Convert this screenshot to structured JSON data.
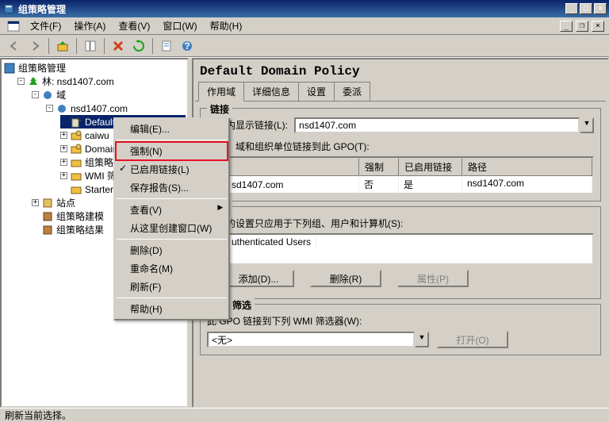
{
  "window": {
    "title": "组策略管理"
  },
  "menubar": {
    "file": "文件(F)",
    "action": "操作(A)",
    "view": "查看(V)",
    "window": "窗口(W)",
    "help": "帮助(H)"
  },
  "tree": {
    "root": "组策略管理",
    "forest": "林: nsd1407.com",
    "domains": "域",
    "domain": "nsd1407.com",
    "defpolicy": "Default Domain Policy",
    "caiwu": "caiwu",
    "domaincontrollers": "Domair",
    "gpobjects": "组策略",
    "wmi": "WMI 筛",
    "starter": "Starter",
    "sites": "站点",
    "gpmodel": "组策略建模",
    "gpresult": "组策略结果"
  },
  "context_menu": {
    "edit": "编辑(E)...",
    "enforce": "强制(N)",
    "link_enabled": "已启用链接(L)",
    "save_report": "保存报告(S)...",
    "view": "查看(V)",
    "new_window": "从这里创建窗口(W)",
    "delete": "删除(D)",
    "rename": "重命名(M)",
    "refresh": "刷新(F)",
    "help": "帮助(H)"
  },
  "right": {
    "heading": "Default Domain Policy",
    "tabs": {
      "scope": "作用域",
      "details": "详细信息",
      "settings": "设置",
      "delegation": "委派"
    },
    "links": {
      "legend": "链接",
      "show_label": "位置内显示链接(L):",
      "show_value": "nsd1407.com",
      "desc": "站点、域和组织单位链接到此 GPO(T):",
      "col_location": "",
      "col_enforced": "强制",
      "col_link_enabled": "已启用链接",
      "col_path": "路径",
      "row_loc": "sd1407.com",
      "row_enf": "否",
      "row_le": "是",
      "row_path": "nsd1407.com"
    },
    "filter": {
      "legend": "筛选",
      "desc": "D 内的设置只应用于下列组、用户和计算机(S):",
      "row": "uthenticated Users",
      "add": "添加(D)...",
      "remove": "删除(R)",
      "props": "属性(P)"
    },
    "wmi": {
      "legend": "WMI 筛选",
      "desc": "此 GPO 链接到下列 WMI 筛选器(W):",
      "value": "<无>",
      "open": "打开(O)"
    }
  },
  "status": "刷新当前选择。"
}
